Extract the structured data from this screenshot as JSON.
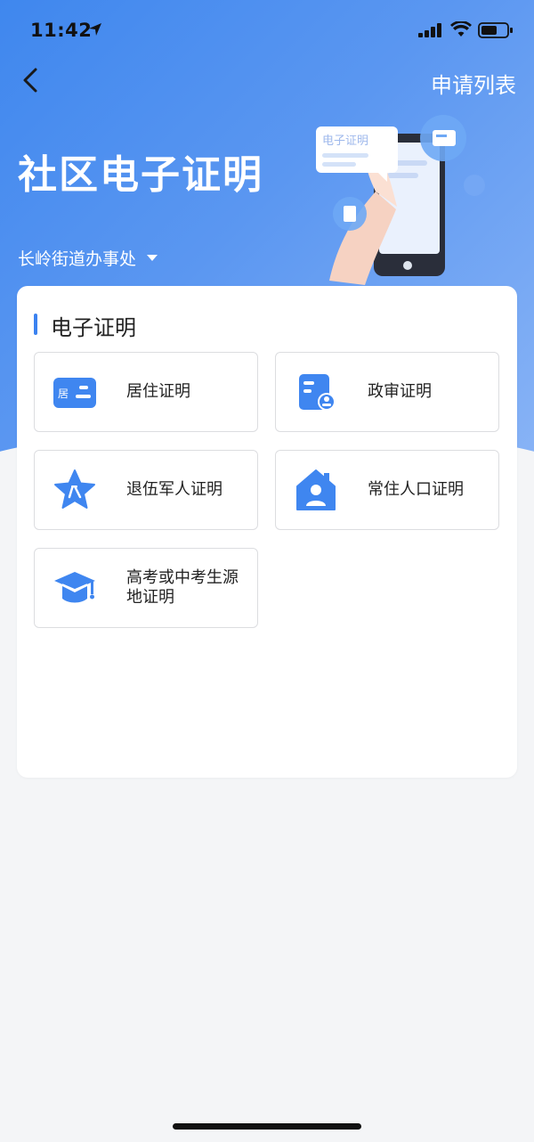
{
  "status_bar": {
    "time": "11:42"
  },
  "header": {
    "apply_list": "申请列表",
    "title": "社区电子证明",
    "office": "长岭街道办事处",
    "illustration_bubble": "电子证明"
  },
  "section": {
    "title": "电子证明",
    "items": [
      {
        "label": "居住证明",
        "icon": "residence-card-icon"
      },
      {
        "label": "政审证明",
        "icon": "political-review-doc-icon"
      },
      {
        "label": "退伍军人证明",
        "icon": "veteran-star-icon"
      },
      {
        "label": "常住人口证明",
        "icon": "house-person-icon"
      },
      {
        "label": "高考或中考生源地证明",
        "icon": "graduation-cap-icon"
      }
    ]
  },
  "colors": {
    "accent": "#3b82f0",
    "header_gradient_start": "#3f87ee",
    "header_gradient_end": "#8bb5f6",
    "background": "#f4f5f7"
  }
}
